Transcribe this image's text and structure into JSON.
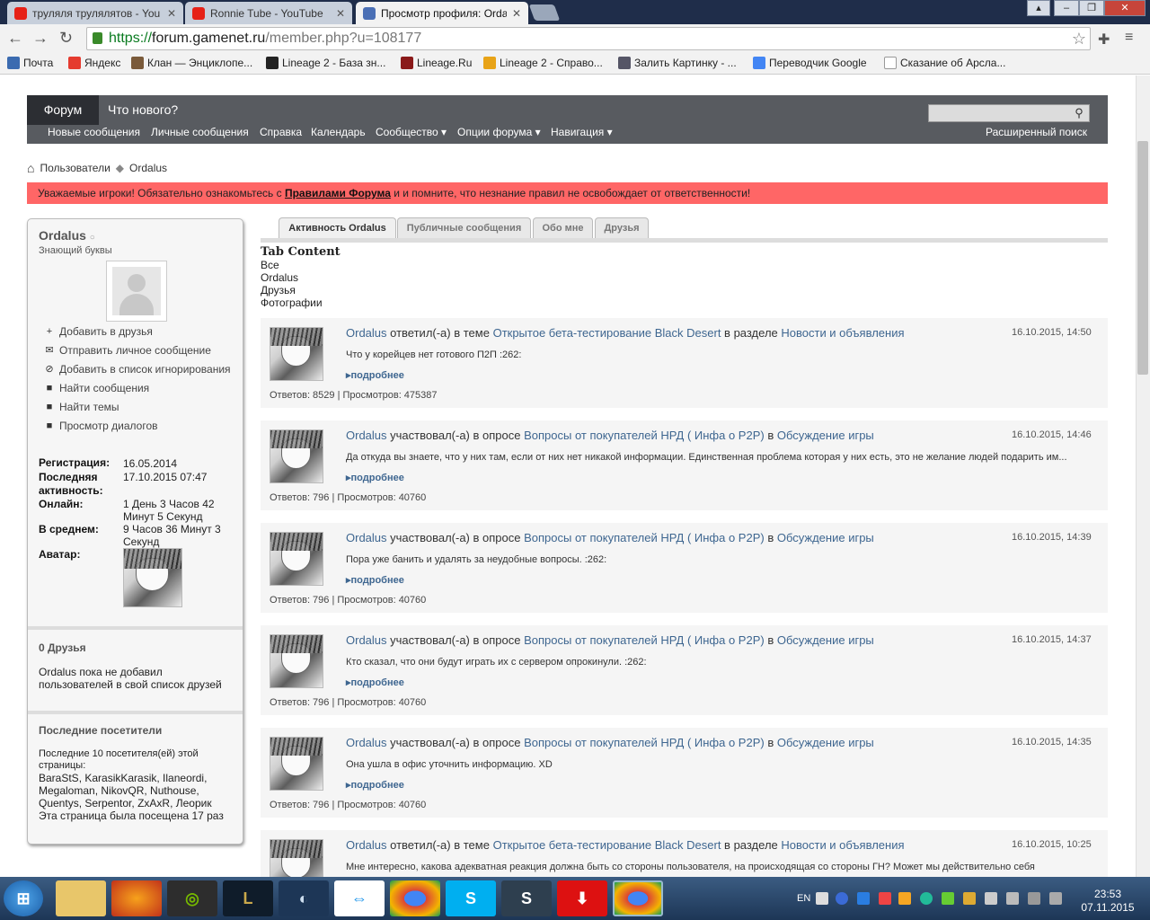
{
  "browser": {
    "tabs": [
      {
        "title": "труляля трулялятов - You",
        "favicon_color": "#e62117"
      },
      {
        "title": "Ronnie Tube - YouTube",
        "favicon_color": "#e62117"
      },
      {
        "title": "Просмотр профиля: Orda",
        "favicon_color": "#4a6fb5"
      }
    ],
    "url": {
      "scheme": "https://",
      "host": "forum.gamenet.ru",
      "path": "/member.php?u=108177"
    },
    "bookmarks": [
      {
        "label": "Почта",
        "icon": "mail-icon"
      },
      {
        "label": "Яндекс",
        "icon": "yandex-icon"
      },
      {
        "label": "Клан — Энциклопе...",
        "icon": "clan-icon"
      },
      {
        "label": "Lineage 2 - База зн...",
        "icon": "lineage-icon"
      },
      {
        "label": "Lineage.Ru",
        "icon": "lineage-ru-icon"
      },
      {
        "label": "Lineage 2 - Справо...",
        "icon": "lineage-guide-icon"
      },
      {
        "label": "Залить Картинку - ...",
        "icon": "upload-icon"
      },
      {
        "label": "Переводчик Google",
        "icon": "google-translate-icon"
      },
      {
        "label": "Сказание об Арсла...",
        "icon": "page-icon"
      }
    ]
  },
  "navbar": {
    "tab_forum": "Форум",
    "tab_whatsnew": "Что нового?",
    "links": [
      "Новые сообщения",
      "Личные сообщения",
      "Справка",
      "Календарь",
      "Сообщество ▾",
      "Опции форума ▾",
      "Навигация ▾"
    ],
    "advanced_search": "Расширенный поиск"
  },
  "breadcrumb": {
    "item1": "Пользователи",
    "item2": "Ordalus"
  },
  "notice": {
    "before": "Уважаемые игроки! Обязательно ознакомьтесь с ",
    "link": "Правилами Форума",
    "after": " и и помните, что незнание правил не освобождает от ответственности!",
    "bg_color": "#ff6666"
  },
  "profile": {
    "username": "Ordalus",
    "status_icon": "offline-icon",
    "rank": "Знающий буквы",
    "actions": [
      {
        "label": "Добавить в друзья",
        "icon": "plus-icon"
      },
      {
        "label": "Отправить личное сообщение",
        "icon": "envelope-icon"
      },
      {
        "label": "Добавить в список игнорирования",
        "icon": "ignore-icon"
      },
      {
        "label": "Найти сообщения",
        "icon": "posts-icon"
      },
      {
        "label": "Найти темы",
        "icon": "threads-icon"
      },
      {
        "label": "Просмотр диалогов",
        "icon": "dialogs-icon"
      }
    ],
    "stats": {
      "registration_label": "Регистрация:",
      "registration_value": "16.05.2014",
      "last_activity_label": "Последняя активность:",
      "last_activity_value": "17.10.2015 07:47",
      "online_label": "Онлайн:",
      "online_value": "1 День 3 Часов 42 Минут 5 Секунд",
      "average_label": "В среднем:",
      "average_value": "9 Часов 36 Минут 3 Секунд",
      "avatar_label": "Аватар:"
    },
    "friends_title": "0 Друзья",
    "friends_text": "Ordalus пока не добавил пользователей в свой список друзей",
    "visitors_title": "Последние посетители",
    "visitors_intro": "Последние 10 посетителя(ей) этой страницы:",
    "visitors_list": "BaraStS, KarasikKarasik, Ilaneordi, Megaloman, NikovQR, Nuthouse, Quentys, Serpentor, ZxAxR, Леорик",
    "visits": "Эта страница была посещена 17 раз"
  },
  "profile_tabs": [
    "Активность Ordalus",
    "Публичные сообщения",
    "Обо мне",
    "Друзья"
  ],
  "tab_content": {
    "title": "Tab Content",
    "filters": [
      "Все",
      "Ordalus",
      "Друзья",
      "Фотографии"
    ]
  },
  "activity": [
    {
      "user": "Ordalus",
      "verb": " ответил(-а) в теме ",
      "topic": "Открытое бета-тестирование Black Desert",
      "prep": " в разделе ",
      "section": "Новости и объявления",
      "date": "16.10.2015, 14:50",
      "text": "Что у корейцев нет готового П2П :262:",
      "more": "подробнее",
      "stats": "Ответов: 8529 | Просмотров: 475387"
    },
    {
      "user": "Ordalus",
      "verb": " участвовал(-а) в опросе ",
      "topic": "Вопросы от покупателей НРД ( Инфа о P2P)",
      "prep": " в ",
      "section": "Обсуждение игры",
      "date": "16.10.2015, 14:46",
      "text": "Да откуда вы знаете, что у них там, если от них нет никакой информации. Единственная проблема которая у них есть, это не желание людей подарить им...",
      "more": "подробнее",
      "stats": "Ответов: 796 | Просмотров: 40760"
    },
    {
      "user": "Ordalus",
      "verb": " участвовал(-а) в опросе ",
      "topic": "Вопросы от покупателей НРД ( Инфа о P2P)",
      "prep": " в ",
      "section": "Обсуждение игры",
      "date": "16.10.2015, 14:39",
      "text": "Пора уже банить и удалять за неудобные вопросы. :262:",
      "more": "подробнее",
      "stats": "Ответов: 796 | Просмотров: 40760"
    },
    {
      "user": "Ordalus",
      "verb": " участвовал(-а) в опросе ",
      "topic": "Вопросы от покупателей НРД ( Инфа о P2P)",
      "prep": " в ",
      "section": "Обсуждение игры",
      "date": "16.10.2015, 14:37",
      "text": "Кто сказал, что они будут играть их с сервером опрокинули. :262:",
      "more": "подробнее",
      "stats": "Ответов: 796 | Просмотров: 40760"
    },
    {
      "user": "Ordalus",
      "verb": " участвовал(-а) в опросе ",
      "topic": "Вопросы от покупателей НРД ( Инфа о P2P)",
      "prep": " в ",
      "section": "Обсуждение игры",
      "date": "16.10.2015, 14:35",
      "text": "Она ушла в офис уточнить информацию. XD",
      "more": "подробнее",
      "stats": "Ответов: 796 | Просмотров: 40760"
    },
    {
      "user": "Ordalus",
      "verb": " ответил(-а) в теме ",
      "topic": "Открытое бета-тестирование Black Desert",
      "prep": " в разделе ",
      "section": "Новости и объявления",
      "date": "16.10.2015, 10:25",
      "text": "Мне интересно, какова адекватная реакция должна быть со стороны пользователя, на происходящая со стороны ГН? Может мы действительно себя",
      "more": "",
      "stats": ""
    }
  ],
  "taskbar": {
    "lang": "EN",
    "time": "23:53",
    "date": "07.11.2015",
    "apps": [
      "start-orb",
      "explorer",
      "firefox",
      "nvidia",
      "league-of-legends",
      "steam",
      "teamviewer",
      "chrome",
      "skype",
      "sublime",
      "downloader",
      "chrome-active"
    ]
  }
}
